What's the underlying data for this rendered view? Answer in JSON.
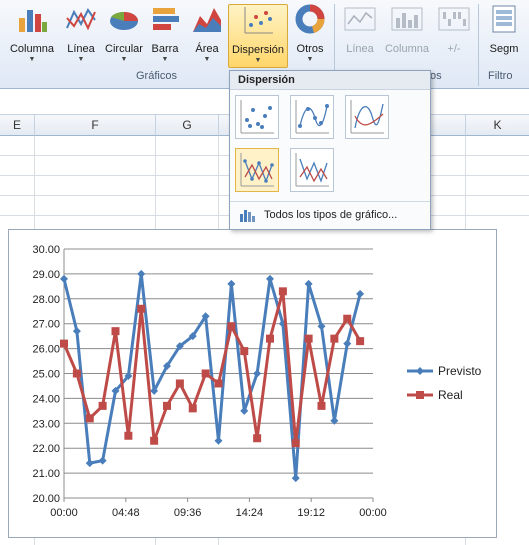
{
  "ribbon": {
    "buttons": [
      {
        "label": "Columna",
        "icon": "column-chart-icon"
      },
      {
        "label": "Línea",
        "icon": "line-chart-icon"
      },
      {
        "label": "Circular",
        "icon": "pie-chart-icon"
      },
      {
        "label": "Barra",
        "icon": "bar-chart-icon"
      },
      {
        "label": "Área",
        "icon": "area-chart-icon"
      },
      {
        "label": "Dispersión",
        "icon": "scatter-chart-icon"
      },
      {
        "label": "Otros",
        "icon": "donut-chart-icon"
      }
    ],
    "sparklines": [
      {
        "label": "Línea",
        "icon": "sparkline-line-icon"
      },
      {
        "label": "Columna",
        "icon": "sparkline-column-icon"
      },
      {
        "label": "+/-",
        "icon": "sparkline-winloss-icon"
      }
    ],
    "filter_button": {
      "label": "Segm",
      "icon": "slicer-icon"
    },
    "group_labels": {
      "charts": "Gráficos",
      "sparklines": "os",
      "filter": "Filtro"
    }
  },
  "columns": [
    "E",
    "F",
    "G",
    "K"
  ],
  "dropdown": {
    "title": "Dispersión",
    "footer_label": "Todos los tipos de gráfico...",
    "footer_icon": "all-chart-types-icon",
    "options": [
      {
        "name": "scatter-markers-only",
        "selected": false
      },
      {
        "name": "scatter-smooth-lines-markers",
        "selected": false
      },
      {
        "name": "scatter-smooth-lines",
        "selected": false
      },
      {
        "name": "scatter-straight-lines-markers",
        "selected": true
      },
      {
        "name": "scatter-straight-lines",
        "selected": false
      }
    ]
  },
  "chart_data": {
    "type": "line",
    "y_ticks": [
      "20.00",
      "21.00",
      "22.00",
      "23.00",
      "24.00",
      "25.00",
      "26.00",
      "27.00",
      "28.00",
      "29.00",
      "30.00"
    ],
    "x_ticks": [
      "00:00",
      "04:48",
      "09:36",
      "14:24",
      "19:12",
      "00:00"
    ],
    "ylim": [
      20,
      30
    ],
    "xlim": [
      0,
      24
    ],
    "grid": true,
    "legend_position": "right",
    "series": [
      {
        "name": "Previsto",
        "color": "#4a7ebb",
        "marker": "diamond",
        "x": [
          0,
          1,
          2,
          3,
          4,
          5,
          6,
          7,
          8,
          9,
          10,
          11,
          12,
          13,
          14,
          15,
          16,
          17,
          18,
          19,
          20,
          21,
          22,
          23,
          24
        ],
        "values": [
          28.8,
          26.7,
          21.4,
          21.5,
          24.3,
          24.9,
          29.0,
          24.3,
          25.3,
          26.1,
          26.5,
          27.3,
          22.3,
          28.6,
          23.5,
          25.0,
          28.8,
          27.0,
          20.8,
          28.6,
          26.9,
          23.1,
          26.2,
          28.2,
          null
        ]
      },
      {
        "name": "Real",
        "color": "#be4b48",
        "marker": "square",
        "x": [
          0,
          1,
          2,
          3,
          4,
          5,
          6,
          7,
          8,
          9,
          10,
          11,
          12,
          13,
          14,
          15,
          16,
          17,
          18,
          19,
          20,
          21,
          22,
          23,
          24
        ],
        "values": [
          26.2,
          25.0,
          23.2,
          23.7,
          26.7,
          22.5,
          27.6,
          22.3,
          23.7,
          24.6,
          23.6,
          25.0,
          24.6,
          26.9,
          25.9,
          22.4,
          26.4,
          28.3,
          22.2,
          26.4,
          23.7,
          26.4,
          27.2,
          26.3,
          null
        ]
      }
    ]
  }
}
